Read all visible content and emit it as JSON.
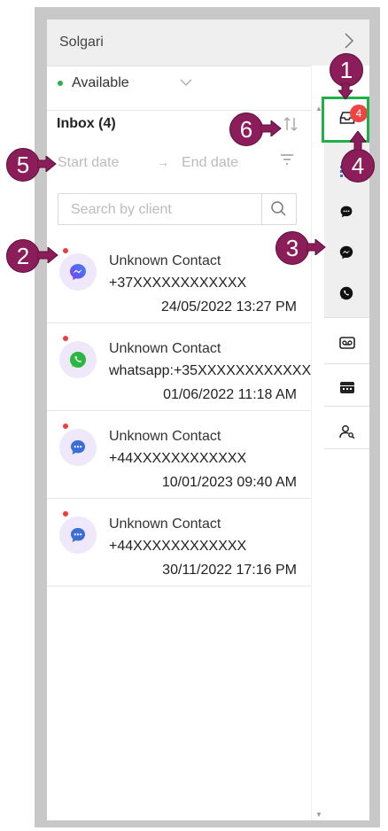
{
  "header": {
    "title": "Solgari",
    "collapse_icon": "chevron-right-icon"
  },
  "status": {
    "label": "Available",
    "color": "#2db24b"
  },
  "inbox": {
    "title": "Inbox (4)",
    "sort_icon": "sort-icon"
  },
  "filters": {
    "start_placeholder": "Start date",
    "end_placeholder": "End date",
    "arrow": "→",
    "filter_icon": "filter-icon"
  },
  "search": {
    "placeholder": "Search by client",
    "icon": "search-icon"
  },
  "conversations": [
    {
      "name": "Unknown Contact",
      "number": "+37XXXXXXXXXXXX",
      "time": "24/05/2022 13:27 PM",
      "channel": "messenger-icon"
    },
    {
      "name": "Unknown Contact",
      "number": "whatsapp:+35XXXXXXXXXXXX",
      "time": "01/06/2022 11:18 AM",
      "channel": "whatsapp-icon"
    },
    {
      "name": "Unknown Contact",
      "number": "+44XXXXXXXXXXXX",
      "time": "10/01/2023 09:40 AM",
      "channel": "chat-icon"
    },
    {
      "name": "Unknown Contact",
      "number": "+44XXXXXXXXXXXX",
      "time": "30/11/2022 17:16 PM",
      "channel": "chat-icon"
    }
  ],
  "rail": {
    "inbox_badge": "4",
    "icons": [
      "inbox-icon",
      "list-icon",
      "chat-icon",
      "messenger-icon",
      "whatsapp-icon",
      "voicemail-icon",
      "calendar-icon",
      "contacts-icon"
    ]
  },
  "markers": [
    "1",
    "2",
    "3",
    "4",
    "5",
    "6"
  ],
  "colors": {
    "marker": "#8b1d5b",
    "highlight": "#1fb04a",
    "badge": "#ee4444",
    "unread": "#ee3d3d",
    "accent": "#3b6fd6"
  }
}
